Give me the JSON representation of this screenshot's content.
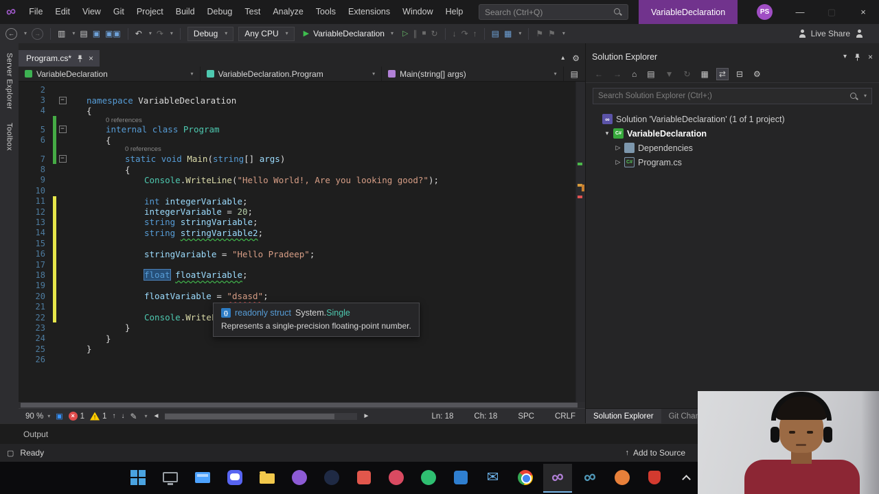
{
  "colors": {
    "accent_purple": "#71338d",
    "selection_blue": "#264f78",
    "change_green": "#45ab45",
    "change_yellow": "#e6e64a",
    "error_red": "#e04c4c",
    "warning_yellow": "#ffcc00"
  },
  "window": {
    "title_badge": "VariableDeclaration",
    "avatar": "PS"
  },
  "menubar": {
    "items": [
      "File",
      "Edit",
      "View",
      "Git",
      "Project",
      "Build",
      "Debug",
      "Test",
      "Analyze",
      "Tools",
      "Extensions",
      "Window",
      "Help"
    ],
    "search_placeholder": "Search (Ctrl+Q)"
  },
  "toolbar": {
    "config": "Debug",
    "platform": "Any CPU",
    "start_button": "VariableDeclaration",
    "live_share": "Live Share"
  },
  "side_tabs": [
    "Server Explorer",
    "Toolbox"
  ],
  "editor": {
    "tab_title": "Program.cs*",
    "breadcrumbs": [
      {
        "label": "VariableDeclaration"
      },
      {
        "label": "VariableDeclaration.Program"
      },
      {
        "label": "Main(string[] args)"
      }
    ],
    "code_lens_label": "0 references",
    "lines": [
      {
        "n": 2
      },
      {
        "n": 3,
        "ind": 0,
        "fold": true,
        "toks": [
          [
            "namespace ",
            "kw"
          ],
          [
            "VariableDeclaration",
            "pl"
          ]
        ]
      },
      {
        "n": 4,
        "ind": 0,
        "toks": [
          [
            "{",
            "pl"
          ]
        ]
      },
      {
        "n": 5,
        "ind": 1,
        "fold": true,
        "lens": true,
        "chg": "g",
        "toks": [
          [
            "internal ",
            "kw"
          ],
          [
            "class ",
            "kw"
          ],
          [
            "Program",
            "type"
          ]
        ]
      },
      {
        "n": 6,
        "ind": 1,
        "chg": "g",
        "toks": [
          [
            "{",
            "pl"
          ]
        ]
      },
      {
        "n": 7,
        "ind": 2,
        "fold": true,
        "lens": true,
        "chg": "g",
        "toks": [
          [
            "static ",
            "kw"
          ],
          [
            "void ",
            "kw"
          ],
          [
            "Main",
            "method"
          ],
          [
            "(",
            "pl"
          ],
          [
            "string",
            "kw"
          ],
          [
            "[] ",
            "pl"
          ],
          [
            "args",
            "param"
          ],
          [
            ")",
            "pl"
          ]
        ]
      },
      {
        "n": 8,
        "ind": 2,
        "toks": [
          [
            "{",
            "pl"
          ]
        ]
      },
      {
        "n": 9,
        "ind": 3,
        "toks": [
          [
            "Console",
            "type"
          ],
          [
            ".",
            "pl"
          ],
          [
            "WriteLine",
            "method"
          ],
          [
            "(",
            "pl"
          ],
          [
            "\"Hello World!, Are you looking good?\"",
            "str"
          ],
          [
            ");",
            "pl"
          ]
        ]
      },
      {
        "n": 10
      },
      {
        "n": 11,
        "ind": 3,
        "chg": "y",
        "toks": [
          [
            "int ",
            "kw"
          ],
          [
            "integerVariable",
            "var"
          ],
          [
            ";",
            "pl"
          ]
        ]
      },
      {
        "n": 12,
        "ind": 3,
        "chg": "y",
        "toks": [
          [
            "integerVariable",
            "var"
          ],
          [
            " = ",
            "pl"
          ],
          [
            "20",
            "num"
          ],
          [
            ";",
            "pl"
          ]
        ]
      },
      {
        "n": 13,
        "ind": 3,
        "chg": "y",
        "toks": [
          [
            "string ",
            "kw"
          ],
          [
            "stringVariable",
            "var"
          ],
          [
            ";",
            "pl"
          ]
        ]
      },
      {
        "n": 14,
        "ind": 3,
        "chg": "y",
        "toks": [
          [
            "string ",
            "kw"
          ],
          [
            "stringVariable2",
            "var warn"
          ],
          [
            ";",
            "pl"
          ]
        ]
      },
      {
        "n": 15,
        "chg": "y"
      },
      {
        "n": 16,
        "ind": 3,
        "chg": "y",
        "toks": [
          [
            "stringVariable",
            "var"
          ],
          [
            " = ",
            "pl"
          ],
          [
            "\"Hello Pradeep\"",
            "str"
          ],
          [
            ";",
            "pl"
          ]
        ]
      },
      {
        "n": 17,
        "chg": "y"
      },
      {
        "n": 18,
        "ind": 3,
        "chg": "y",
        "toks": [
          [
            "float",
            "kw sel"
          ],
          [
            " ",
            "pl"
          ],
          [
            "floatVariable",
            "var warn"
          ],
          [
            ";",
            "pl"
          ]
        ]
      },
      {
        "n": 19,
        "chg": "y"
      },
      {
        "n": 20,
        "ind": 3,
        "chg": "y",
        "toks": [
          [
            "floatVariable",
            "var"
          ],
          [
            " = ",
            "pl"
          ],
          [
            "\"dsasd\"",
            "str err"
          ],
          [
            ";",
            "pl"
          ]
        ]
      },
      {
        "n": 21,
        "chg": "y"
      },
      {
        "n": 22,
        "ind": 3,
        "chg": "y",
        "toks": [
          [
            "Console",
            "type"
          ],
          [
            ".",
            "pl"
          ],
          [
            "WriteLi",
            "method"
          ]
        ]
      },
      {
        "n": 23,
        "ind": 2,
        "toks": [
          [
            "}",
            "pl"
          ]
        ]
      },
      {
        "n": 24,
        "ind": 1,
        "toks": [
          [
            "}",
            "pl"
          ]
        ]
      },
      {
        "n": 25,
        "ind": 0,
        "toks": [
          [
            "}",
            "pl"
          ]
        ]
      },
      {
        "n": 26
      }
    ],
    "status": {
      "zoom": "90 %",
      "error_count": "1",
      "warning_count": "1",
      "ln": "Ln: 18",
      "ch": "Ch: 18",
      "spc": "SPC",
      "eol": "CRLF"
    }
  },
  "tooltip": {
    "signature_kind": "readonly struct",
    "signature_ns": "System.",
    "signature_type": "Single",
    "description": "Represents a single-precision floating-point number."
  },
  "solution_explorer": {
    "title": "Solution Explorer",
    "search_placeholder": "Search Solution Explorer (Ctrl+;)",
    "toolbar_icons": [
      {
        "name": "back-icon",
        "glyph": "←",
        "disabled": true
      },
      {
        "name": "forward-icon",
        "glyph": "→",
        "disabled": true
      },
      {
        "name": "home-icon",
        "glyph": "⌂"
      },
      {
        "name": "switch-views-icon",
        "glyph": "▤"
      },
      {
        "name": "pending-changes-filter-icon",
        "glyph": "▼",
        "disabled": true
      },
      {
        "name": "refresh-icon",
        "glyph": "↻",
        "disabled": true
      },
      {
        "name": "file-nesting-icon",
        "glyph": "▦"
      },
      {
        "name": "sync-with-active-document-icon",
        "glyph": "⇄",
        "active": true
      },
      {
        "name": "collapse-all-icon",
        "glyph": "⊟"
      },
      {
        "name": "properties-icon",
        "glyph": "⚙"
      }
    ],
    "tree": [
      {
        "label": "Solution 'VariableDeclaration' (1 of 1 project)",
        "icon": "solution",
        "indent": 0,
        "expander": ""
      },
      {
        "label": "VariableDeclaration",
        "icon": "csproj",
        "indent": 1,
        "expander": "expanded",
        "bold": true
      },
      {
        "label": "Dependencies",
        "icon": "dependencies",
        "indent": 2,
        "expander": "collapsed"
      },
      {
        "label": "Program.cs",
        "icon": "csfile",
        "indent": 2,
        "expander": "collapsed"
      }
    ],
    "bottom_tabs": [
      {
        "label": "Solution Explorer",
        "active": true
      },
      {
        "label": "Git Chang",
        "active": false
      }
    ]
  },
  "output": {
    "title": "Output"
  },
  "statusbar": {
    "ready": "Ready",
    "right": "Add to Source"
  },
  "taskbar": {
    "items": [
      {
        "name": "start-icon",
        "kind": "win"
      },
      {
        "name": "monitor-app-icon",
        "kind": "monitor"
      },
      {
        "name": "window-app-icon",
        "kind": "window",
        "color": "#4da3ff"
      },
      {
        "name": "chat-app-icon",
        "kind": "chat",
        "color": "#5865f2"
      },
      {
        "name": "file-explorer-icon",
        "kind": "folder",
        "color": "#f2c94c"
      },
      {
        "name": "app-purple-icon",
        "kind": "circle",
        "color": "#8d5bd4"
      },
      {
        "name": "steam-icon",
        "kind": "circle",
        "color": "#1f2a44"
      },
      {
        "name": "app-orange-icon",
        "kind": "square",
        "color": "#e2574c"
      },
      {
        "name": "app-red-icon",
        "kind": "circle",
        "color": "#d94a61"
      },
      {
        "name": "app-green-icon",
        "kind": "circle",
        "color": "#2fbf71"
      },
      {
        "name": "app-blue-icon",
        "kind": "square",
        "color": "#2f7fd0"
      },
      {
        "name": "mail-icon",
        "kind": "mail",
        "color": "#6db3ea"
      },
      {
        "name": "chrome-icon",
        "kind": "chrome"
      },
      {
        "name": "visual-studio-icon",
        "kind": "vs",
        "color": "#b180d7",
        "active": true
      },
      {
        "name": "visual-studio-blue-icon",
        "kind": "vs",
        "color": "#519aba"
      },
      {
        "name": "app-orange2-icon",
        "kind": "circle",
        "color": "#e8803a"
      },
      {
        "name": "shield-app-icon",
        "kind": "shield",
        "color": "#d33a2f"
      },
      {
        "name": "tray-chevron-icon",
        "kind": "chev"
      }
    ]
  }
}
